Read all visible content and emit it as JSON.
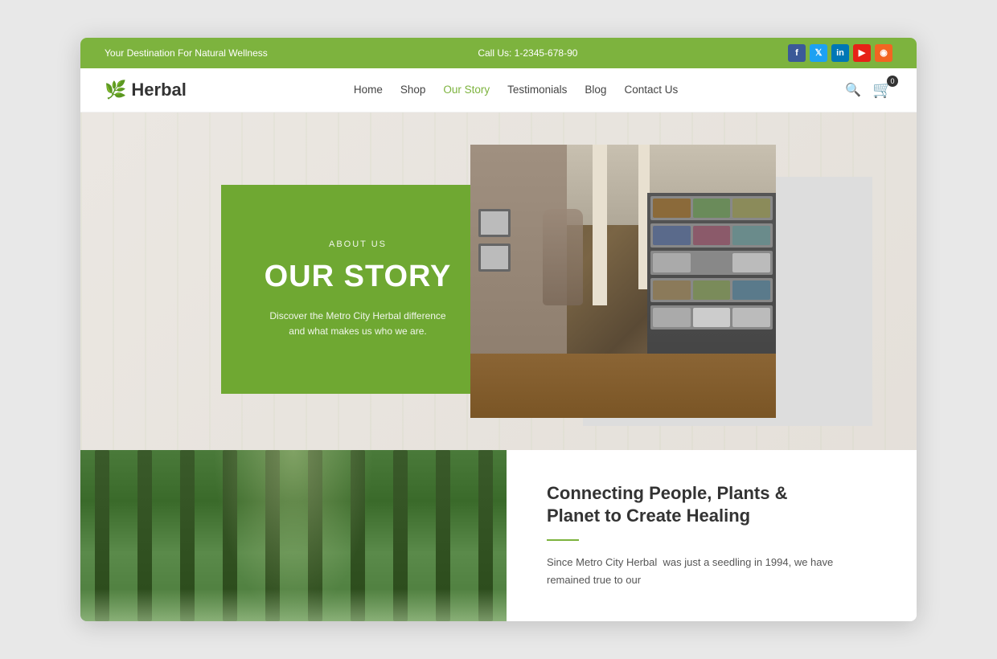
{
  "topBar": {
    "tagline": "Your Destination For Natural Wellness",
    "phone": "Call Us: 1-2345-678-90",
    "social": [
      {
        "name": "facebook",
        "label": "f",
        "class": "social-fb"
      },
      {
        "name": "twitter",
        "label": "t",
        "class": "social-tw"
      },
      {
        "name": "linkedin",
        "label": "in",
        "class": "social-li"
      },
      {
        "name": "youtube",
        "label": "▶",
        "class": "social-yt"
      },
      {
        "name": "rss",
        "label": "◉",
        "class": "social-rss"
      }
    ]
  },
  "nav": {
    "logo": "Herbal",
    "links": [
      {
        "label": "Home",
        "active": false
      },
      {
        "label": "Shop",
        "active": false
      },
      {
        "label": "Our Story",
        "active": true
      },
      {
        "label": "Testimonials",
        "active": false
      },
      {
        "label": "Blog",
        "active": false
      },
      {
        "label": "Contact Us",
        "active": false
      }
    ],
    "cartCount": "0"
  },
  "hero": {
    "aboutLabel": "ABOUT US",
    "title": "OUR STORY",
    "description": "Discover the Metro City Herbal difference and what makes us who we are."
  },
  "bottomSection": {
    "title": "Connecting People, Plants &\nPlanet to Create Healing",
    "description": "Since Metro City Herbal  was just a seedling in 1994, we have remained true to our"
  }
}
